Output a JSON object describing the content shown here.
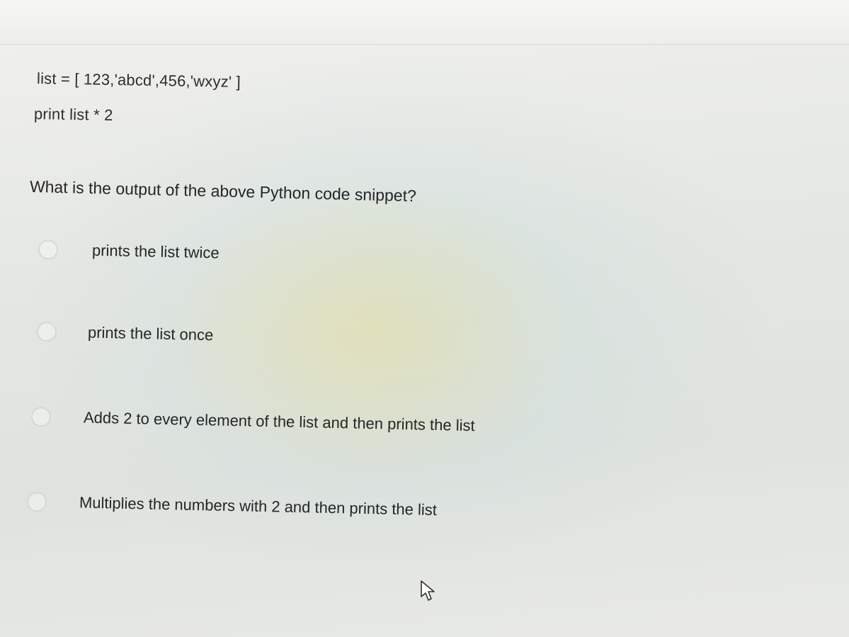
{
  "code": {
    "line1": "list = [ 123,'abcd',456,'wxyz' ]",
    "line2": "print list * 2"
  },
  "question": {
    "text": "What is the output of the above Python code snippet?"
  },
  "options": [
    {
      "label": "prints the list twice"
    },
    {
      "label": "prints the list once"
    },
    {
      "label": "Adds 2 to every element of the list and then prints the list"
    },
    {
      "label": "Multiplies the numbers with 2 and then prints the list"
    }
  ],
  "icons": {
    "radio": "radio-circle-icon",
    "cursor": "mouse-pointer-icon"
  },
  "colors": {
    "text": "#2b2b2b",
    "radio_border": "#d6d8d4"
  }
}
